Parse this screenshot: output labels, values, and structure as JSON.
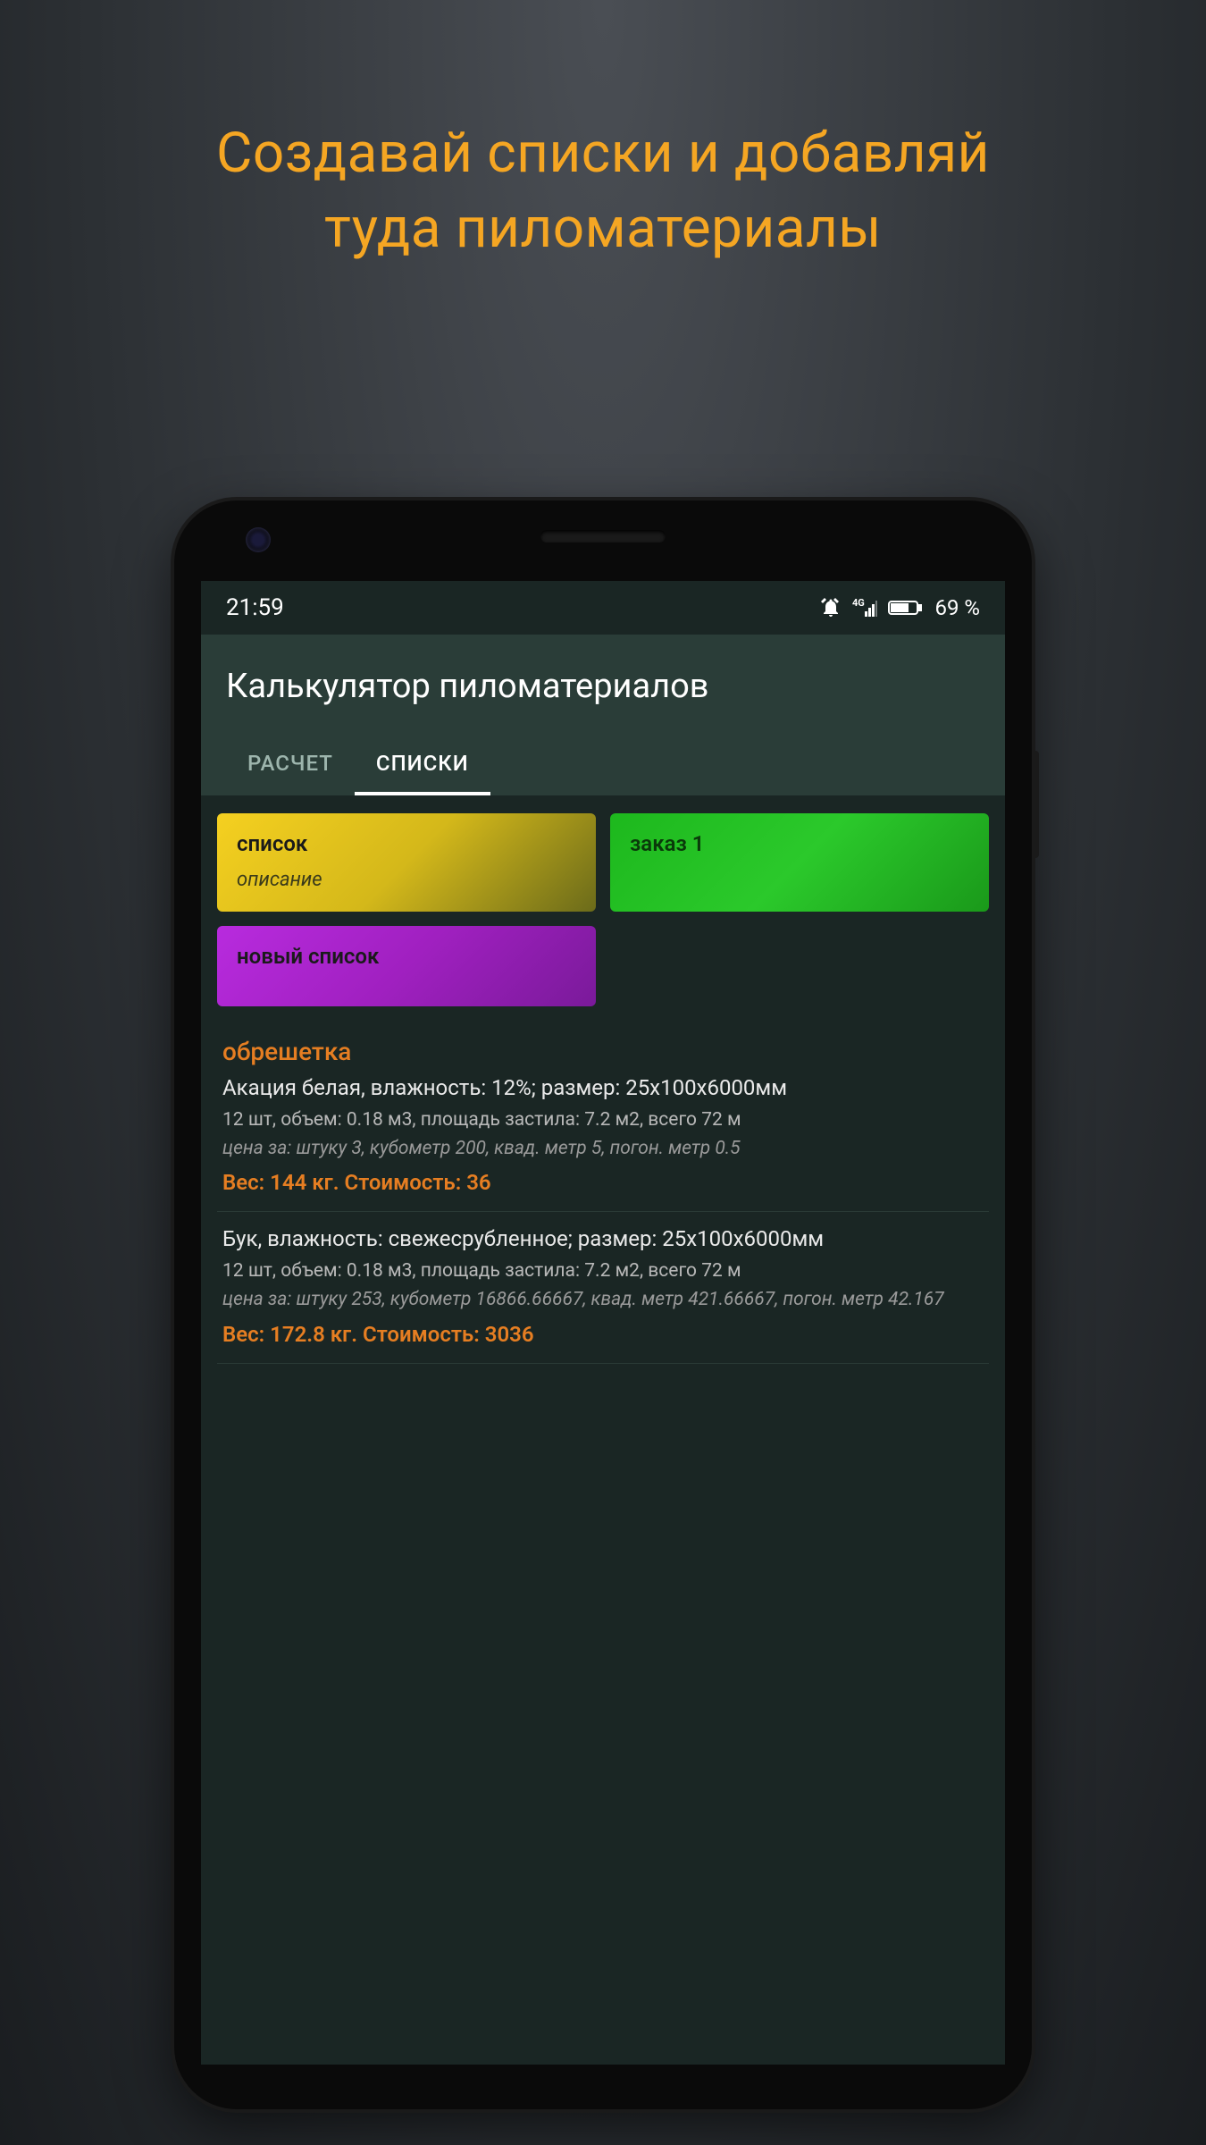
{
  "promo": {
    "line1": "Создавай списки и добавляй",
    "line2": "туда пиломатериалы"
  },
  "statusBar": {
    "time": "21:59",
    "battery": "69 %",
    "network": "4G"
  },
  "header": {
    "title": "Калькулятор пиломатериалов"
  },
  "tabs": {
    "calc": "РАСЧЕТ",
    "lists": "СПИСКИ"
  },
  "cards": {
    "yellow": {
      "title": "список",
      "desc": "описание"
    },
    "green": {
      "title": "заказ 1"
    },
    "purple": {
      "title": "новый список"
    }
  },
  "items": {
    "item1": {
      "title": "обрешетка",
      "spec": "Акация белая, влажность: 12%; размер: 25x100x6000мм",
      "detail": "12 шт, объем: 0.18 м3, площадь застила: 7.2 м2, всего 72 м",
      "price": "цена за: штуку 3, кубометр 200, квад. метр 5, погон. метр 0.5",
      "result": "Вес: 144 кг. Стоимость: 36"
    },
    "item2": {
      "spec": "Бук, влажность: свежесрубленное; размер: 25x100x6000мм",
      "detail": "12 шт, объем: 0.18 м3, площадь застила: 7.2 м2, всего 72 м",
      "price": "цена за: штуку 253, кубометр 16866.66667, квад. метр 421.66667, погон. метр 42.167",
      "result": "Вес: 172.8 кг. Стоимость: 3036"
    }
  }
}
